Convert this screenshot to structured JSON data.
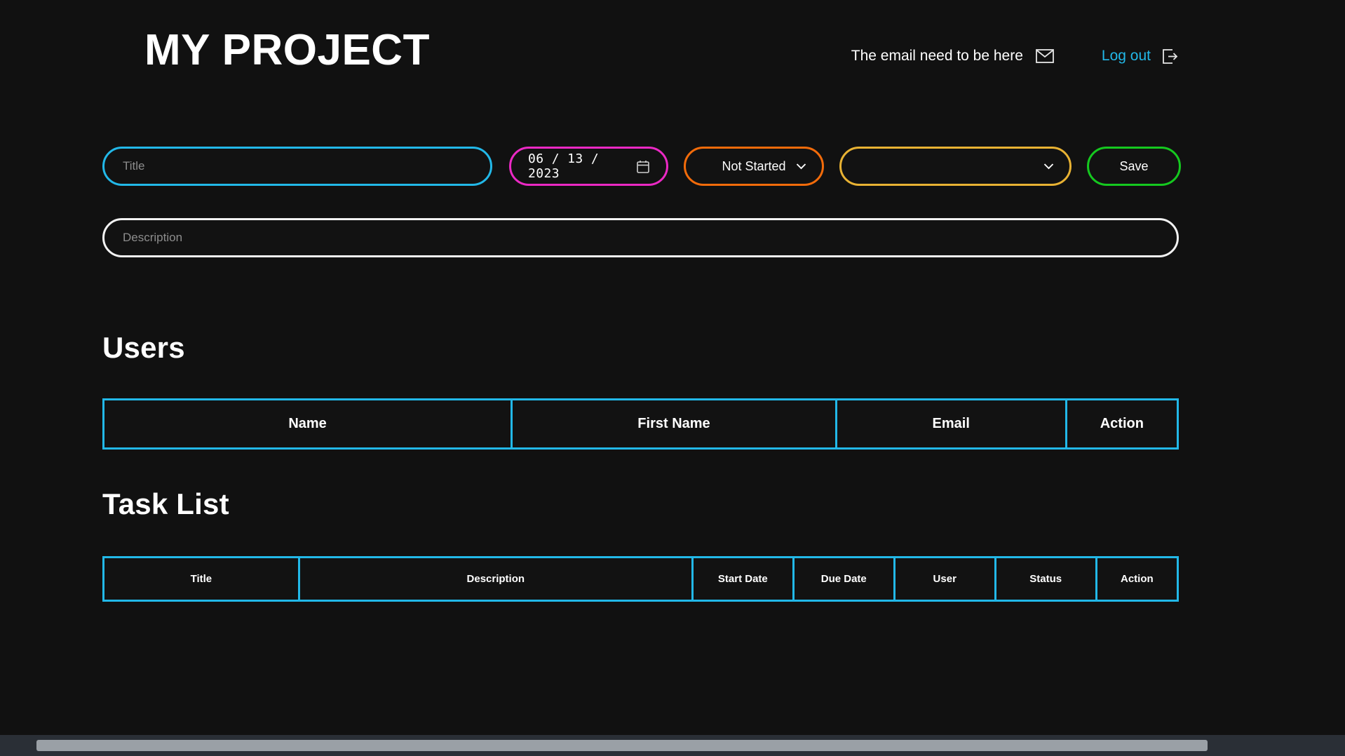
{
  "header": {
    "app_title": "MY PROJECT",
    "email_text": "The email need to be here",
    "email_icon": "envelope-icon",
    "logout_label": "Log out",
    "logout_icon": "logout-icon"
  },
  "form": {
    "title_placeholder": "Title",
    "title_value": "",
    "date_value": "06 / 13 / 2023",
    "date_icon": "calendar-icon",
    "status_value": "Not Started",
    "status_options": [
      "Not Started"
    ],
    "user_value": "",
    "user_options": [],
    "save_label": "Save",
    "description_placeholder": "Description",
    "description_value": "",
    "colors": {
      "title_border": "#22b8e8",
      "date_border": "#eb29c4",
      "status_border": "#f26b0a",
      "user_border": "#e8b233",
      "save_border": "#15c81f",
      "description_border": "#f2f2f2"
    }
  },
  "users_section": {
    "heading": "Users",
    "columns": [
      "Name",
      "First Name",
      "Email",
      "Action"
    ],
    "rows": []
  },
  "tasks_section": {
    "heading": "Task List",
    "columns": [
      "Title",
      "Description",
      "Start Date",
      "Due Date",
      "User",
      "Status",
      "Action"
    ],
    "rows": []
  },
  "theme": {
    "background": "#111111",
    "accent": "#22b8e8",
    "text": "#ffffff",
    "placeholder": "#8d8d8d",
    "scrollbar_track": "#2a2f36",
    "scrollbar_thumb": "#9aa0a6"
  }
}
